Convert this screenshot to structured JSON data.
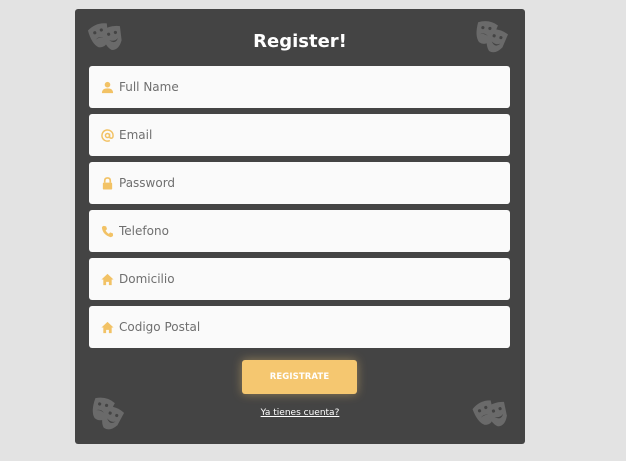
{
  "form": {
    "title": "Register!",
    "fields": [
      {
        "placeholder": "Full Name",
        "icon": "user-icon"
      },
      {
        "placeholder": "Email",
        "icon": "at-icon"
      },
      {
        "placeholder": "Password",
        "icon": "lock-icon"
      },
      {
        "placeholder": "Telefono",
        "icon": "phone-icon"
      },
      {
        "placeholder": "Domicilio",
        "icon": "home-icon"
      },
      {
        "placeholder": "Codigo Postal",
        "icon": "home-icon"
      }
    ],
    "submit_label": "REGISTRATE",
    "login_link": "Ya tienes cuenta?"
  },
  "colors": {
    "card": "#444444",
    "accent": "#f5c770",
    "background": "#e3e3e3"
  },
  "decorations": [
    "theater-masks-icon",
    "theater-masks-icon",
    "theater-masks-icon",
    "theater-masks-icon"
  ]
}
